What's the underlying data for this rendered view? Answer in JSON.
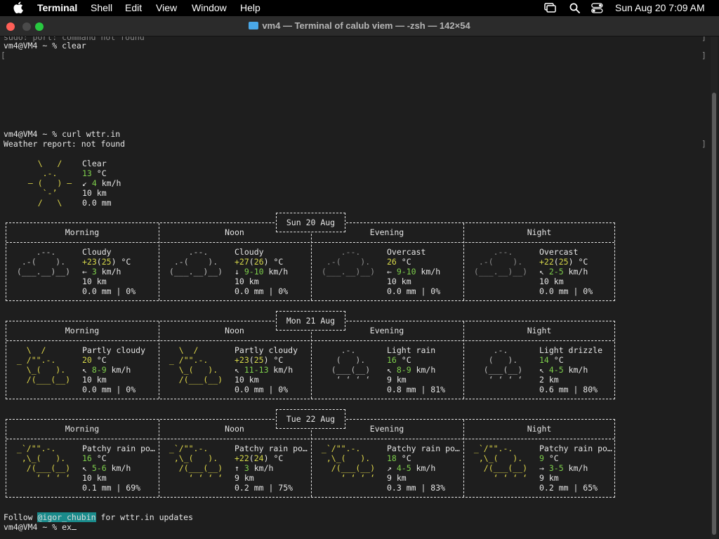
{
  "menubar": {
    "items": [
      "Terminal",
      "Shell",
      "Edit",
      "View",
      "Window",
      "Help"
    ],
    "datetime": "Sun Aug 20  7:09 AM"
  },
  "window": {
    "title": "vm4 — Terminal of calub viem — -zsh — 142×54"
  },
  "terminal": {
    "partial_line": "sudo: port: command not found",
    "prompt1": "vm4@VM4 ~ % clear",
    "prompt2": "vm4@VM4 ~ % curl wttr.in",
    "report": "Weather report: not found",
    "current": {
      "art": "    \\   /    \n     .-.     \n  ― (   ) ―  \n     `-’     \n    /   \\    ",
      "condition": "Clear",
      "temp": "13",
      "temp_unit": " °C",
      "wind_arrow": "↙",
      "wind": "4",
      "wind_unit": " km/h",
      "visibility": "10 km",
      "precip": "0.0 mm"
    },
    "periods": [
      "Morning",
      "Noon",
      "Evening",
      "Night"
    ],
    "days": [
      {
        "label": "Sun 20 Aug",
        "cells": [
          {
            "art_type": "cloudy",
            "condition": "Cloudy",
            "temp": "+23",
            "feels": "25",
            "temp_unit": " °C",
            "wind_arrow": "←",
            "wind": "3",
            "wind_unit": " km/h",
            "visibility": "10 km",
            "precip": "0.0 mm | 0%"
          },
          {
            "art_type": "cloudy",
            "condition": "Cloudy",
            "temp": "+27",
            "feels": "26",
            "temp_unit": " °C",
            "wind_arrow": "↓",
            "wind": "9-10",
            "wind_unit": " km/h",
            "visibility": "10 km",
            "precip": "0.0 mm | 0%"
          },
          {
            "art_type": "overcast",
            "condition": "Overcast",
            "temp": "26",
            "feels": "",
            "temp_unit": " °C",
            "wind_arrow": "←",
            "wind": "9-10",
            "wind_unit": " km/h",
            "visibility": "10 km",
            "precip": "0.0 mm | 0%"
          },
          {
            "art_type": "overcast",
            "condition": "Overcast",
            "temp": "+22",
            "feels": "25",
            "temp_unit": " °C",
            "wind_arrow": "↖",
            "wind": "2-5",
            "wind_unit": " km/h",
            "visibility": "10 km",
            "precip": "0.0 mm | 0%"
          }
        ]
      },
      {
        "label": "Mon 21 Aug",
        "cells": [
          {
            "art_type": "partly",
            "condition": "Partly cloudy",
            "temp": "20",
            "feels": "",
            "temp_unit": " °C",
            "wind_arrow": "↖",
            "wind": "8-9",
            "wind_unit": " km/h",
            "visibility": "10 km",
            "precip": "0.0 mm | 0%"
          },
          {
            "art_type": "partly",
            "condition": "Partly cloudy",
            "temp": "+23",
            "feels": "25",
            "temp_unit": " °C",
            "wind_arrow": "↖",
            "wind": "11-13",
            "wind_unit": " km/h",
            "visibility": "10 km",
            "precip": "0.0 mm | 0%"
          },
          {
            "art_type": "rain",
            "condition": "Light rain",
            "temp": "16",
            "feels": "",
            "temp_unit": " °C",
            "wind_arrow": "↖",
            "wind": "8-9",
            "wind_unit": " km/h",
            "visibility": "9 km",
            "precip": "0.8 mm | 81%"
          },
          {
            "art_type": "rain",
            "condition": "Light drizzle",
            "temp": "14",
            "feels": "",
            "temp_unit": " °C",
            "wind_arrow": "↖",
            "wind": "4-5",
            "wind_unit": " km/h",
            "visibility": "2 km",
            "precip": "0.6 mm | 80%"
          }
        ]
      },
      {
        "label": "Tue 22 Aug",
        "cells": [
          {
            "art_type": "patchy",
            "condition": "Patchy rain po…",
            "temp": "16",
            "feels": "",
            "temp_unit": " °C",
            "wind_arrow": "↖",
            "wind": "5-6",
            "wind_unit": " km/h",
            "visibility": "10 km",
            "precip": "0.1 mm | 69%"
          },
          {
            "art_type": "patchy",
            "condition": "Patchy rain po…",
            "temp": "+22",
            "feels": "24",
            "temp_unit": " °C",
            "wind_arrow": "↑",
            "wind": "3",
            "wind_unit": " km/h",
            "visibility": "9 km",
            "precip": "0.2 mm | 75%"
          },
          {
            "art_type": "patchy",
            "condition": "Patchy rain po…",
            "temp": "18",
            "feels": "",
            "temp_unit": " °C",
            "wind_arrow": "↗",
            "wind": "4-5",
            "wind_unit": " km/h",
            "visibility": "9 km",
            "precip": "0.3 mm | 83%"
          },
          {
            "art_type": "patchy",
            "condition": "Patchy rain po…",
            "temp": "9",
            "feels": "",
            "temp_unit": " °C",
            "wind_arrow": "→",
            "wind": "3-5",
            "wind_unit": " km/h",
            "visibility": "9 km",
            "precip": "0.2 mm | 65%"
          }
        ]
      }
    ],
    "follow_prefix": "Follow ",
    "follow_handle": "@igor_chubin",
    "follow_suffix": " for wttr.in updates",
    "prompt3": "vm4@VM4 ~ % ex"
  },
  "art": {
    "cloudy": "     .--.    \n  .-(    ).  \n (___.__)__) ",
    "overcast": "     .--.    \n  .-(    ).  \n (___.__)__) ",
    "partly": "   \\  /      \n _ /\"\".-.    \n   \\_(   ).  \n   /(___(__) ",
    "rain": "     .-.     \n    (   ).   \n   (___(__)  \n    ‘ ‘ ‘ ‘  ",
    "patchy": " _`/\"\".-.    \n  ,\\_(   ).  \n   /(___(__) \n     ‘ ‘ ‘ ‘ "
  },
  "colors": {
    "temp_warm": "#d6d84a",
    "temp_cool": "#7fd04c",
    "wind": "#e6a23c",
    "handle_bg": "#1a8b8b"
  }
}
